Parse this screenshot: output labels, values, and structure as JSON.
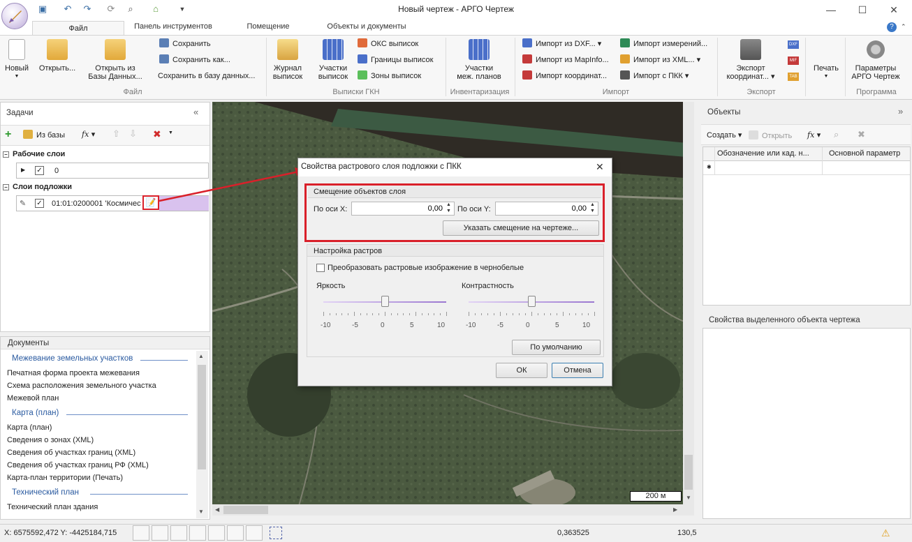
{
  "window": {
    "title": "Новый чертеж - АРГО Чертеж"
  },
  "tabs": [
    {
      "label": "Файл"
    },
    {
      "label": "Панель инструментов"
    },
    {
      "label": "Помещение"
    },
    {
      "label": "Объекты и документы"
    }
  ],
  "ribbon": {
    "file": {
      "new": "Новый",
      "open": "Открыть...",
      "open_db_1": "Открыть из",
      "open_db_2": "Базы Данных...",
      "save": "Сохранить",
      "save_as": "Сохранить как...",
      "save_db": "Сохранить в базу данных...",
      "group": "Файл"
    },
    "gkn": {
      "journal_1": "Журнал",
      "journal_2": "выписок",
      "parcels_1": "Участки",
      "parcels_2": "выписок",
      "oks": "ОКС выписок",
      "borders": "Границы выписок",
      "zones": "Зоны выписок",
      "group": "Выписки ГКН"
    },
    "inv": {
      "parcels_1": "Участки",
      "parcels_2": "меж. планов",
      "group": "Инвентаризация"
    },
    "import": {
      "dxf": "Импорт из DXF...",
      "mapinfo": "Импорт из MapInfo...",
      "coords": "Импорт координат...",
      "measures": "Импорт измерений...",
      "xml": "Импорт из XML...",
      "pkk": "Импорт с ПКК",
      "group": "Импорт"
    },
    "export": {
      "coords_1": "Экспорт",
      "coords_2": "координат...",
      "dxf": "DXF",
      "mif": "MIF",
      "tab": "TAB",
      "group": "Экспорт"
    },
    "program": {
      "print": "Печать",
      "params_1": "Параметры",
      "params_2": "АРГО Чертеж",
      "group": "Программа"
    }
  },
  "tasks": {
    "title": "Задачи",
    "from_db": "Из базы",
    "fx": "fx",
    "work_layers": "Рабочие слои",
    "work_layer_name": "0",
    "base_layers": "Слои подложки",
    "base_layer_name": "01:01:0200001 'Космичес"
  },
  "documents": {
    "title": "Документы",
    "sections": [
      {
        "heading": "Межевание земельных участков",
        "items": [
          "Печатная форма проекта межевания",
          "Схема расположения земельного участка",
          "Межевой план"
        ]
      },
      {
        "heading": "Карта (план)",
        "items": [
          "Карта (план)",
          "Сведения о зонах (XML)",
          "Сведения об участках границ (XML)",
          "Сведения об участках границ РФ (XML)",
          "Карта-план территории (Печать)"
        ]
      },
      {
        "heading": "Технический план",
        "items": [
          "Технический план здания"
        ]
      }
    ]
  },
  "map": {
    "scale_label": "200 м"
  },
  "dialog": {
    "title": "Свойства растрового слоя подложки с ПКК",
    "offset_group": "Смещение объектов слоя",
    "x_label": "По оси X:",
    "x_value": "0,00",
    "y_label": "По оси Y:",
    "y_value": "0,00",
    "pick_offset": "Указать смещение на чертеже...",
    "raster_group": "Настройка растров",
    "grayscale_label": "Преобразовать растровые изображение в чернобелые",
    "grayscale_checked": false,
    "brightness_label": "Яркость",
    "contrast_label": "Контрастность",
    "brightness_value": 0,
    "contrast_value": 0,
    "scale_ticks": [
      "-10",
      "-5",
      "0",
      "5",
      "10"
    ],
    "defaults": "По умолчанию",
    "ok": "ОК",
    "cancel": "Отмена"
  },
  "objects": {
    "title": "Объекты",
    "create": "Создать",
    "open": "Открыть",
    "fx": "fx",
    "col1": "Обозначение или кад. н...",
    "col2": "Основной параметр"
  },
  "props": {
    "title": "Свойства выделенного объекта чертежа"
  },
  "status": {
    "coords": "X: 6575592,472 Y: -4425184,715",
    "value1": "0,363525",
    "value2": "130,5"
  },
  "colors": {
    "highlight": "#d9202a",
    "accent": "#2a5aa0",
    "purple": "#d9c2ee"
  }
}
